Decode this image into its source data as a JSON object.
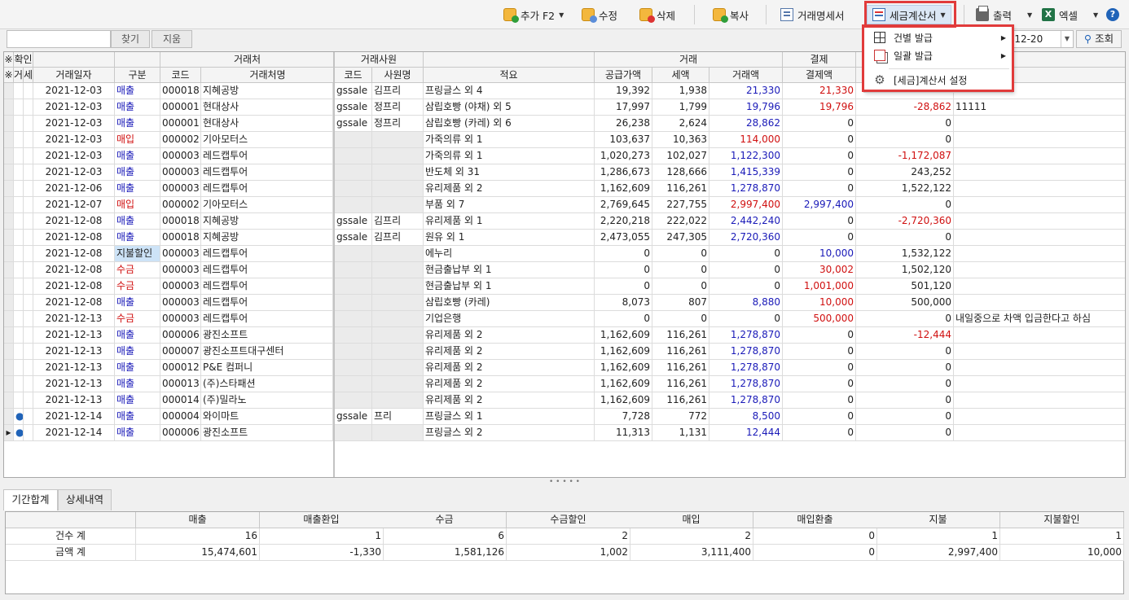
{
  "toolbar": {
    "add": "추가 F2",
    "edit": "수정",
    "delete": "삭제",
    "copy": "복사",
    "statement": "거래명세서",
    "tax_invoice": "세금계산서",
    "print": "출력",
    "excel": "엑셀",
    "help": "?"
  },
  "menu": {
    "items": [
      {
        "label": "건별 발급",
        "submenu": true
      },
      {
        "label": "일괄 발급",
        "submenu": true
      },
      {
        "label": "[세금]계산서 설정",
        "submenu": false
      }
    ]
  },
  "search": {
    "find": "찾기",
    "clear": "지움",
    "date_to": "-12-20",
    "query": "조회"
  },
  "grid": {
    "group_headers": {
      "confirm": "확인",
      "client": "거래처",
      "staff": "거래사원",
      "trade": "거래",
      "settle": "결제"
    },
    "col_headers": {
      "mark1": "※",
      "mark2": "※",
      "geo": "거",
      "se": "세",
      "date": "거래일자",
      "type": "구분",
      "code": "코드",
      "client_name": "거래처명",
      "staff_code": "코드",
      "staff_name": "사원명",
      "memo": "적요",
      "supply": "공급가액",
      "tax": "세액",
      "amount": "거래액",
      "settle_amount": "결제액"
    },
    "rows": [
      {
        "ind": "",
        "g": "",
        "s": "",
        "date": "2021-12-03",
        "type": "매출",
        "tcol": "blue",
        "code": "000018",
        "name": "지혜공방",
        "sc": "gssale",
        "sn": "김프리",
        "memo": "프링글스 외 4",
        "supply": "19,392",
        "tax": "1,938",
        "amt": "21,330",
        "acol": "blue",
        "settle": "21,330",
        "scol": "red",
        "bal": "",
        "bcol": "",
        "note": ""
      },
      {
        "ind": "",
        "g": "",
        "s": "",
        "date": "2021-12-03",
        "type": "매출",
        "tcol": "blue",
        "code": "000001",
        "name": "현대상사",
        "sc": "gssale",
        "sn": "정프리",
        "memo": "삼립호빵 (야채) 외 5",
        "supply": "17,997",
        "tax": "1,799",
        "amt": "19,796",
        "acol": "blue",
        "settle": "19,796",
        "scol": "red",
        "bal": "-28,862",
        "bcol": "red",
        "note": "11111"
      },
      {
        "ind": "",
        "g": "",
        "s": "",
        "date": "2021-12-03",
        "type": "매출",
        "tcol": "blue",
        "code": "000001",
        "name": "현대상사",
        "sc": "gssale",
        "sn": "정프리",
        "memo": "삼립호빵 (카레) 외 6",
        "supply": "26,238",
        "tax": "2,624",
        "amt": "28,862",
        "acol": "blue",
        "settle": "0",
        "scol": "",
        "bal": "0",
        "bcol": "",
        "note": ""
      },
      {
        "ind": "",
        "g": "",
        "s": "",
        "date": "2021-12-03",
        "type": "매입",
        "tcol": "red",
        "code": "000002",
        "name": "기아모터스",
        "sc": "",
        "sn": "",
        "memo": "가죽의류 외 1",
        "supply": "103,637",
        "tax": "10,363",
        "amt": "114,000",
        "acol": "red",
        "settle": "0",
        "scol": "",
        "bal": "0",
        "bcol": "",
        "note": ""
      },
      {
        "ind": "",
        "g": "",
        "s": "",
        "date": "2021-12-03",
        "type": "매출",
        "tcol": "blue",
        "code": "000003",
        "name": "레드캡투어",
        "sc": "",
        "sn": "",
        "memo": "가죽의류 외 1",
        "supply": "1,020,273",
        "tax": "102,027",
        "amt": "1,122,300",
        "acol": "blue",
        "settle": "0",
        "scol": "",
        "bal": "-1,172,087",
        "bcol": "red",
        "note": ""
      },
      {
        "ind": "",
        "g": "",
        "s": "",
        "date": "2021-12-03",
        "type": "매출",
        "tcol": "blue",
        "code": "000003",
        "name": "레드캡투어",
        "sc": "",
        "sn": "",
        "memo": "반도체 외 31",
        "supply": "1,286,673",
        "tax": "128,666",
        "amt": "1,415,339",
        "acol": "blue",
        "settle": "0",
        "scol": "",
        "bal": "243,252",
        "bcol": "",
        "note": ""
      },
      {
        "ind": "",
        "g": "",
        "s": "",
        "date": "2021-12-06",
        "type": "매출",
        "tcol": "blue",
        "code": "000003",
        "name": "레드캡투어",
        "sc": "",
        "sn": "",
        "memo": "유리제품 외 2",
        "supply": "1,162,609",
        "tax": "116,261",
        "amt": "1,278,870",
        "acol": "blue",
        "settle": "0",
        "scol": "",
        "bal": "1,522,122",
        "bcol": "",
        "note": ""
      },
      {
        "ind": "",
        "g": "",
        "s": "",
        "date": "2021-12-07",
        "type": "매입",
        "tcol": "red",
        "code": "000002",
        "name": "기아모터스",
        "sc": "",
        "sn": "",
        "memo": "부품 외 7",
        "supply": "2,769,645",
        "tax": "227,755",
        "amt": "2,997,400",
        "acol": "red",
        "settle": "2,997,400",
        "scol": "blue",
        "bal": "0",
        "bcol": "",
        "note": ""
      },
      {
        "ind": "",
        "g": "",
        "s": "",
        "date": "2021-12-08",
        "type": "매출",
        "tcol": "blue",
        "code": "000018",
        "name": "지혜공방",
        "sc": "gssale",
        "sn": "김프리",
        "memo": "유리제품 외 1",
        "supply": "2,220,218",
        "tax": "222,022",
        "amt": "2,442,240",
        "acol": "blue",
        "settle": "0",
        "scol": "",
        "bal": "-2,720,360",
        "bcol": "red",
        "note": ""
      },
      {
        "ind": "",
        "g": "",
        "s": "",
        "date": "2021-12-08",
        "type": "매출",
        "tcol": "blue",
        "code": "000018",
        "name": "지혜공방",
        "sc": "gssale",
        "sn": "김프리",
        "memo": "원유 외 1",
        "supply": "2,473,055",
        "tax": "247,305",
        "amt": "2,720,360",
        "acol": "blue",
        "settle": "0",
        "scol": "",
        "bal": "0",
        "bcol": "",
        "note": ""
      },
      {
        "ind": "",
        "g": "",
        "s": "",
        "date": "2021-12-08",
        "type": "지불할인",
        "tcol": "sel",
        "code": "000003",
        "name": "레드캡투어",
        "sc": "",
        "sn": "",
        "memo": "에누리",
        "supply": "0",
        "tax": "0",
        "amt": "0",
        "acol": "",
        "settle": "10,000",
        "scol": "blue",
        "bal": "1,532,122",
        "bcol": "",
        "note": ""
      },
      {
        "ind": "",
        "g": "",
        "s": "",
        "date": "2021-12-08",
        "type": "수금",
        "tcol": "red",
        "code": "000003",
        "name": "레드캡투어",
        "sc": "",
        "sn": "",
        "memo": "현금출납부 외 1",
        "supply": "0",
        "tax": "0",
        "amt": "0",
        "acol": "",
        "settle": "30,002",
        "scol": "red",
        "bal": "1,502,120",
        "bcol": "",
        "note": ""
      },
      {
        "ind": "",
        "g": "",
        "s": "",
        "date": "2021-12-08",
        "type": "수금",
        "tcol": "red",
        "code": "000003",
        "name": "레드캡투어",
        "sc": "",
        "sn": "",
        "memo": "현금출납부 외 1",
        "supply": "0",
        "tax": "0",
        "amt": "0",
        "acol": "",
        "settle": "1,001,000",
        "scol": "red",
        "bal": "501,120",
        "bcol": "",
        "note": ""
      },
      {
        "ind": "",
        "g": "",
        "s": "",
        "date": "2021-12-08",
        "type": "매출",
        "tcol": "blue",
        "code": "000003",
        "name": "레드캡투어",
        "sc": "",
        "sn": "",
        "memo": "삼립호빵 (카레)",
        "supply": "8,073",
        "tax": "807",
        "amt": "8,880",
        "acol": "blue",
        "settle": "10,000",
        "scol": "red",
        "bal": "500,000",
        "bcol": "",
        "note": ""
      },
      {
        "ind": "",
        "g": "",
        "s": "",
        "date": "2021-12-13",
        "type": "수금",
        "tcol": "red",
        "code": "000003",
        "name": "레드캡투어",
        "sc": "",
        "sn": "",
        "memo": "기업은행",
        "supply": "0",
        "tax": "0",
        "amt": "0",
        "acol": "",
        "settle": "500,000",
        "scol": "red",
        "bal": "0",
        "bcol": "",
        "note": "내일중으로 차액 입금한다고 하심"
      },
      {
        "ind": "",
        "g": "",
        "s": "",
        "date": "2021-12-13",
        "type": "매출",
        "tcol": "blue",
        "code": "000006",
        "name": "광진소프트",
        "sc": "",
        "sn": "",
        "memo": "유리제품 외 2",
        "supply": "1,162,609",
        "tax": "116,261",
        "amt": "1,278,870",
        "acol": "blue",
        "settle": "0",
        "scol": "",
        "bal": "-12,444",
        "bcol": "red",
        "note": ""
      },
      {
        "ind": "",
        "g": "",
        "s": "",
        "date": "2021-12-13",
        "type": "매출",
        "tcol": "blue",
        "code": "000007",
        "name": "광진소프트대구센터",
        "sc": "",
        "sn": "",
        "memo": "유리제품 외 2",
        "supply": "1,162,609",
        "tax": "116,261",
        "amt": "1,278,870",
        "acol": "blue",
        "settle": "0",
        "scol": "",
        "bal": "0",
        "bcol": "",
        "note": ""
      },
      {
        "ind": "",
        "g": "",
        "s": "",
        "date": "2021-12-13",
        "type": "매출",
        "tcol": "blue",
        "code": "000012",
        "name": "P&E 컴퍼니",
        "sc": "",
        "sn": "",
        "memo": "유리제품 외 2",
        "supply": "1,162,609",
        "tax": "116,261",
        "amt": "1,278,870",
        "acol": "blue",
        "settle": "0",
        "scol": "",
        "bal": "0",
        "bcol": "",
        "note": ""
      },
      {
        "ind": "",
        "g": "",
        "s": "",
        "date": "2021-12-13",
        "type": "매출",
        "tcol": "blue",
        "code": "000013",
        "name": "(주)스타패션",
        "sc": "",
        "sn": "",
        "memo": "유리제품 외 2",
        "supply": "1,162,609",
        "tax": "116,261",
        "amt": "1,278,870",
        "acol": "blue",
        "settle": "0",
        "scol": "",
        "bal": "0",
        "bcol": "",
        "note": ""
      },
      {
        "ind": "",
        "g": "",
        "s": "",
        "date": "2021-12-13",
        "type": "매출",
        "tcol": "blue",
        "code": "000014",
        "name": "(주)밀라노",
        "sc": "",
        "sn": "",
        "memo": "유리제품 외 2",
        "supply": "1,162,609",
        "tax": "116,261",
        "amt": "1,278,870",
        "acol": "blue",
        "settle": "0",
        "scol": "",
        "bal": "0",
        "bcol": "",
        "note": ""
      },
      {
        "ind": "",
        "g": "●",
        "s": "",
        "date": "2021-12-14",
        "type": "매출",
        "tcol": "blue",
        "code": "000004",
        "name": "와이마트",
        "sc": "gssale",
        "sn": "프리",
        "memo": "프링글스 외 1",
        "supply": "7,728",
        "tax": "772",
        "amt": "8,500",
        "acol": "blue",
        "settle": "0",
        "scol": "",
        "bal": "0",
        "bcol": "",
        "note": ""
      },
      {
        "ind": "▸",
        "g": "●",
        "s": "",
        "date": "2021-12-14",
        "type": "매출",
        "tcol": "blue",
        "code": "000006",
        "name": "광진소프트",
        "sc": "",
        "sn": "",
        "memo": "프링글스 외 2",
        "supply": "11,313",
        "tax": "1,131",
        "amt": "12,444",
        "acol": "blue",
        "settle": "0",
        "scol": "",
        "bal": "0",
        "bcol": "",
        "note": ""
      }
    ]
  },
  "tabs": [
    "기간합계",
    "상세내역"
  ],
  "summary": {
    "headers": [
      "매출",
      "매출환입",
      "수금",
      "수금할인",
      "매입",
      "매입환출",
      "지불",
      "지불할인"
    ],
    "rows": [
      {
        "label": "건수 계",
        "values": [
          "16",
          "1",
          "6",
          "2",
          "2",
          "0",
          "1",
          "1"
        ]
      },
      {
        "label": "금액 계",
        "values": [
          "15,474,601",
          "-1,330",
          "1,581,126",
          "1,002",
          "3,111,400",
          "0",
          "2,997,400",
          "10,000"
        ]
      }
    ]
  },
  "colors": {
    "accent_red": "#e13b3b",
    "blue_text": "#1a1ab8",
    "red_text": "#d01010"
  }
}
